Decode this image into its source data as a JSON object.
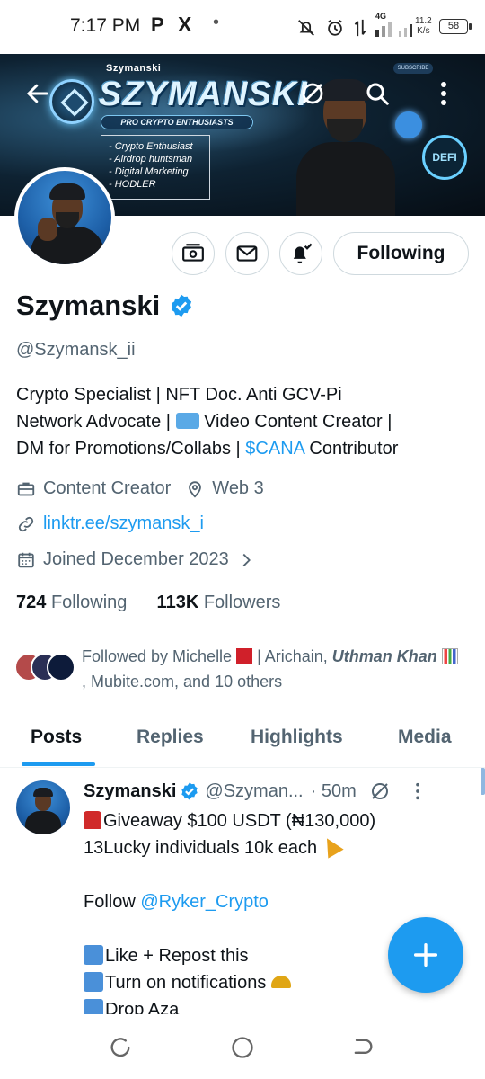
{
  "status_bar": {
    "time": "7:17 PM",
    "app_p": "P",
    "app_x": "X",
    "dot": "•",
    "network": "4G",
    "speed_value": "11.2",
    "speed_unit": "K/s",
    "battery": "58"
  },
  "banner": {
    "brand_small": "Szymanski",
    "brand_big": "SZYMANSKI",
    "tagline": "PRO CRYPTO ENTHUSIASTS",
    "bullets": [
      "- Crypto Enthusiast",
      "- Airdrop huntsman",
      "- Digital Marketing",
      "- HODLER"
    ],
    "subscribe": "SUBSCRIBE",
    "defi": "DEFI"
  },
  "profile": {
    "follow_button": "Following",
    "display_name": "Szymanski",
    "handle": "@Szymansk_ii",
    "bio_line1": "Crypto Specialist | NFT Doc. Anti GCV-Pi",
    "bio_line2_a": "Network Advocate | ",
    "bio_line2_b": " Video Content Creator |",
    "bio_line3_a": "DM for Promotions/Collabs | ",
    "bio_line3_link": "$CANA",
    "bio_line3_b": " Contributor",
    "category": "Content Creator",
    "location": "Web 3",
    "website": "linktr.ee/szymansk_i",
    "joined": "Joined December 2023",
    "following_count": "724",
    "following_label": "Following",
    "followers_count": "113K",
    "followers_label": "Followers",
    "followed_by_a": "Followed by Michelle ",
    "followed_by_b": " | Arichain, ",
    "followed_by_bold": "Uthman Khan",
    "followed_by_c": ", Mubite.com, and 10 others"
  },
  "tabs": [
    "Posts",
    "Replies",
    "Highlights",
    "Media"
  ],
  "post": {
    "name": "Szymanski",
    "handle": "@Szyman...",
    "time": "· 50m",
    "line1": "Giveaway $100 USDT (₦130,000)",
    "line2": "13Lucky individuals 10k each",
    "line3_a": "Follow ",
    "line3_link": "@Ryker_Crypto",
    "line4": "Like + Repost this",
    "line5": "Turn on notifications",
    "line6": "Drop Aza"
  },
  "icons": {
    "back": "back-arrow-icon",
    "grok": "grok-icon",
    "search": "search-icon",
    "more": "more-icon",
    "tip": "tip-icon",
    "message": "message-icon",
    "notify": "notification-bell-icon",
    "verified": "verified-badge-icon",
    "compose": "plus-icon"
  },
  "colors": {
    "accent": "#1d9bf0",
    "secondary_text": "#536471",
    "primary_text": "#0f1419"
  }
}
